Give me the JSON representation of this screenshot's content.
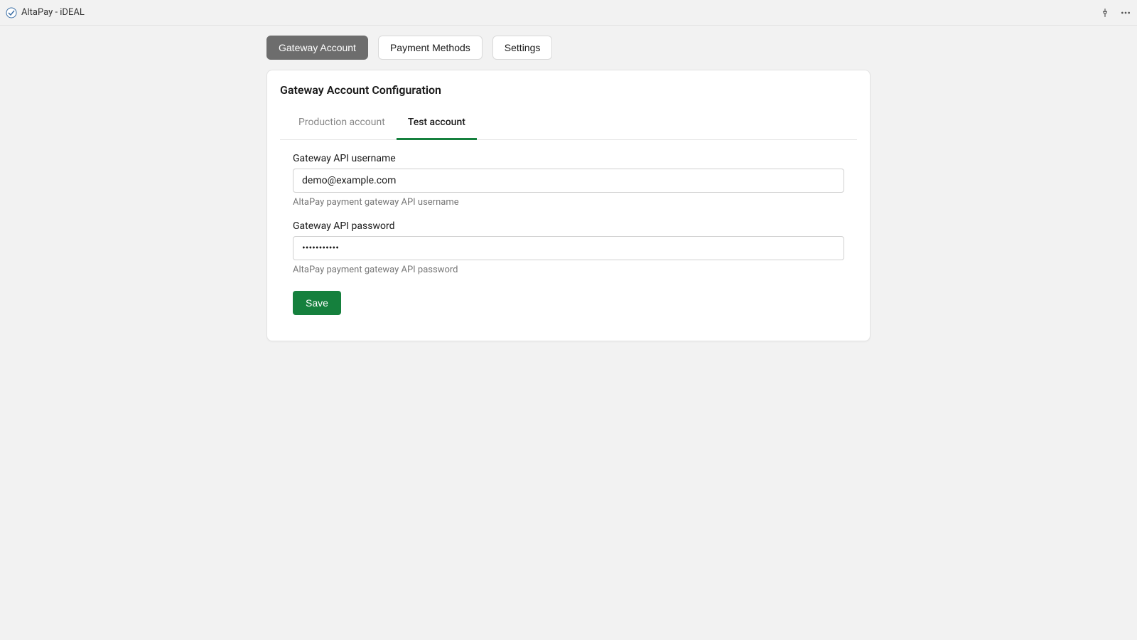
{
  "header": {
    "title": "AltaPay - iDEAL"
  },
  "nav": {
    "items": [
      {
        "label": "Gateway Account",
        "active": true
      },
      {
        "label": "Payment Methods",
        "active": false
      },
      {
        "label": "Settings",
        "active": false
      }
    ]
  },
  "card": {
    "title": "Gateway Account Configuration",
    "subtabs": [
      {
        "label": "Production account",
        "active": false
      },
      {
        "label": "Test account",
        "active": true
      }
    ],
    "form": {
      "username": {
        "label": "Gateway API username",
        "value": "demo@example.com",
        "help": "AltaPay payment gateway API username"
      },
      "password": {
        "label": "Gateway API password",
        "value": "•••••••••••",
        "help": "AltaPay payment gateway API password"
      },
      "save_label": "Save"
    }
  }
}
